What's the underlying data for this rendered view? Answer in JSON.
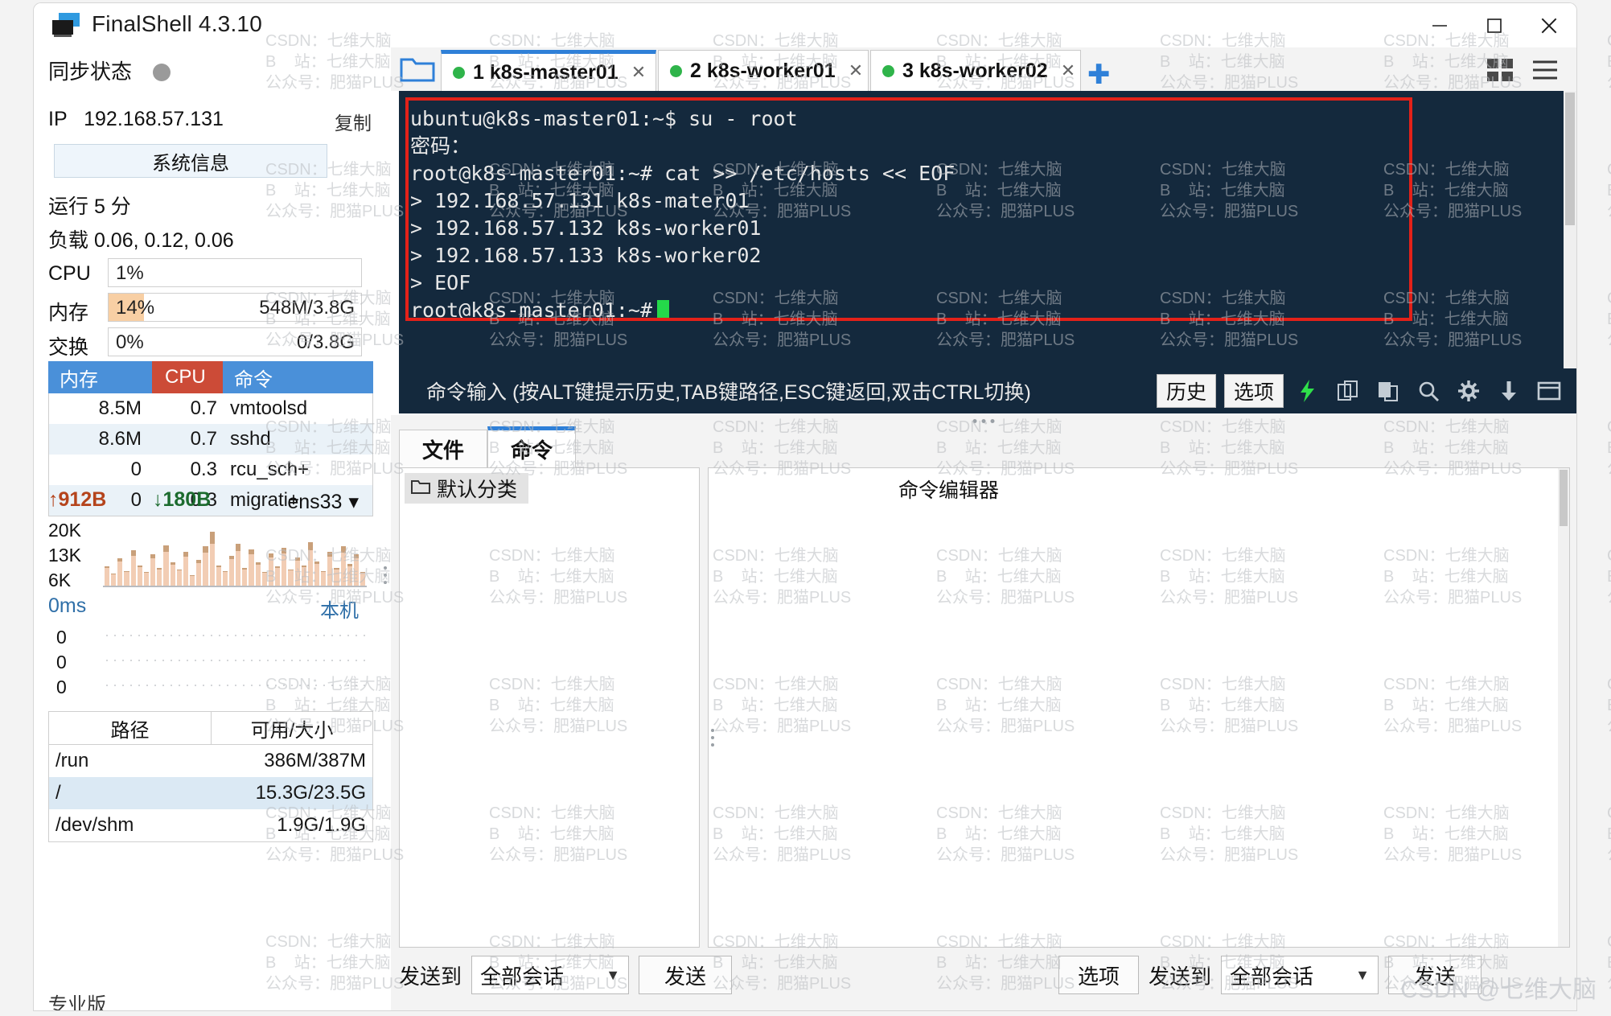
{
  "window": {
    "title": "FinalShell 4.3.10",
    "app_icon": "monitor-icon",
    "minimize_label": "—",
    "maximize_label": "□",
    "close_label": "✕"
  },
  "sidebar": {
    "sync_status_label": "同步状态",
    "ip_label": "IP",
    "ip_value": "192.168.57.131",
    "copy_label": "复制",
    "sysinfo_button": "系统信息",
    "uptime": "运行 5 分",
    "load": "负载 0.06, 0.12, 0.06",
    "metrics": [
      {
        "name": "CPU",
        "percent": "1%",
        "fill": 1,
        "right": "",
        "color": "#ffffff"
      },
      {
        "name": "内存",
        "percent": "14%",
        "fill": 14,
        "right": "548M/3.8G",
        "color": "#f8cfa4"
      },
      {
        "name": "交换",
        "percent": "0%",
        "fill": 0,
        "right": "0/3.8G",
        "color": "#f8cfa4"
      }
    ],
    "process_table": {
      "headers": [
        "内存",
        "CPU",
        "命令"
      ],
      "rows": [
        {
          "mem": "8.5M",
          "cpu": "0.7",
          "cmd": "vmtoolsd"
        },
        {
          "mem": "8.6M",
          "cpu": "0.7",
          "cmd": "sshd"
        },
        {
          "mem": "0",
          "cpu": "0.3",
          "cmd": "rcu_sch+"
        },
        {
          "mem": "0",
          "cpu": "0.3",
          "cmd": "migrati+"
        }
      ]
    },
    "network": {
      "upload": "912B",
      "download": "180B",
      "up_arrow": "arrow-up-icon",
      "down_arrow": "arrow-down-icon",
      "interface": "ens33",
      "axis": [
        "20K",
        "13K",
        "6K"
      ]
    },
    "ping": {
      "value": "0ms",
      "local_label": "本机",
      "axis": [
        "0",
        "0",
        "0"
      ]
    },
    "disk_table": {
      "headers": [
        "路径",
        "可用/大小"
      ],
      "rows": [
        {
          "path": "/run",
          "size": "386M/387M",
          "highlight": false
        },
        {
          "path": "/",
          "size": "15.3G/23.5G",
          "highlight": true
        },
        {
          "path": "/dev/shm",
          "size": "1.9G/1.9G",
          "highlight": false
        }
      ]
    },
    "pro_badge": "专业版"
  },
  "terminal": {
    "folder_icon": "folder-icon",
    "tabs": [
      {
        "label": "1 k8s-master01",
        "active": true,
        "status": "connected",
        "close": "✕"
      },
      {
        "label": "2 k8s-worker01",
        "active": false,
        "status": "connected",
        "close": "✕"
      },
      {
        "label": "3 k8s-worker02",
        "active": false,
        "status": "connected",
        "close": "✕"
      }
    ],
    "add_tab_label": "✚",
    "grid_icon": "grid-view-icon",
    "menu_icon": "hamburger-menu-icon",
    "lines": [
      "ubuntu@k8s-master01:~$ su - root",
      "密码：",
      "root@k8s-master01:~# cat >> /etc/hosts << EOF",
      "> 192.168.57.131 k8s-mater01",
      "> 192.168.57.132 k8s-worker01",
      "> 192.168.57.133 k8s-worker02",
      "> EOF"
    ],
    "prompt": "root@k8s-master01:~#",
    "highlight_color": "#e32119",
    "background": "#14293d"
  },
  "command_bar": {
    "placeholder": "命令输入 (按ALT键提示历史,TAB键路径,ESC键返回,双击CTRL切换)",
    "history_button": "历史",
    "options_button": "选项",
    "icons": [
      "lightning-icon",
      "copy-icon",
      "paste-icon",
      "search-icon",
      "gear-icon",
      "download-icon",
      "window-icon"
    ]
  },
  "bottom_panel": {
    "tabs": [
      {
        "label": "文件",
        "active": false
      },
      {
        "label": "命令",
        "active": true
      }
    ],
    "group_label": "默认分类",
    "group_icon": "folder-icon",
    "editor_label": "命令编辑器",
    "left_send_to_label": "发送到",
    "left_select_value": "全部会话",
    "left_send_button": "发送",
    "right_options_button": "选项",
    "right_send_to_label": "发送到",
    "right_select_value": "全部会话",
    "right_send_button": "发送"
  },
  "watermark": {
    "lines": [
      "CSDN：七维大脑",
      "B    站：七维大脑",
      "公众号：肥猫PLUS"
    ],
    "corner": "CSDN @七维大脑"
  }
}
